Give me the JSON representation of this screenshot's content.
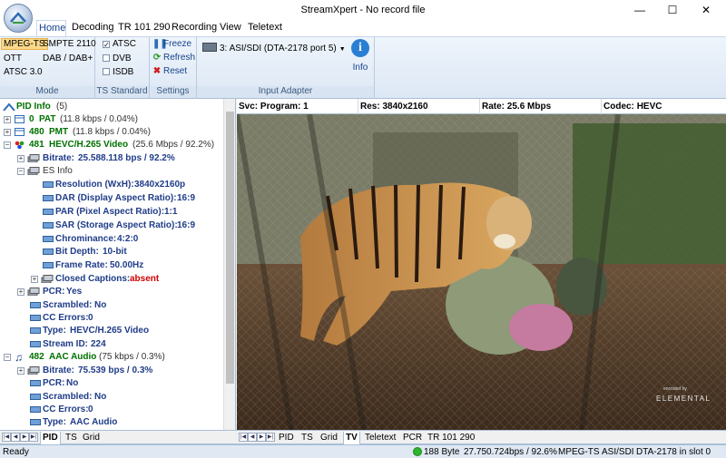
{
  "window": {
    "title": "StreamXpert - No record file",
    "minimize": "—",
    "maximize": "☐",
    "close": "✕"
  },
  "tabs": [
    "Home",
    "Decoding",
    "TR 101 290",
    "Recording",
    "View",
    "Teletext"
  ],
  "ribbon": {
    "mode": {
      "items": [
        "MPEG-TS",
        "SMPTE 2110",
        "OTT",
        "DAB / DAB+",
        "ATSC 3.0"
      ],
      "selected": "MPEG-TS",
      "label": "Mode"
    },
    "ts_standard": {
      "items": [
        {
          "label": "ATSC",
          "checked": true
        },
        {
          "label": "DVB",
          "checked": false
        },
        {
          "label": "ISDB",
          "checked": false
        }
      ],
      "label": "TS Standard"
    },
    "settings": {
      "freeze": "Freeze",
      "refresh": "Refresh",
      "reset": "Reset",
      "label": "Settings"
    },
    "input_adapter": {
      "device": "3: ASI/SDI (DTA-2178 port 5)",
      "label": "Input Adapter",
      "info": "Info"
    }
  },
  "tree": {
    "root_label": "PID Info",
    "root_count": "(5)",
    "pat": {
      "pid": "0",
      "name": "PAT",
      "rate": "(11.8 kbps / 0.04%)"
    },
    "pmt": {
      "pid": "480",
      "name": "PMT",
      "rate": "(11.8 kbps / 0.04%)"
    },
    "video": {
      "pid": "481",
      "name": "HEVC/H.265 Video",
      "rate": "(25.6 Mbps / 92.2%)",
      "bitrate_k": "Bitrate:",
      "bitrate_v": "25.588.118 bps / 92.2%",
      "es_info": "ES Info",
      "res_k": "Resolution (WxH):",
      "res_v": "3840x2160p",
      "dar_k": "DAR (Display Aspect Ratio):",
      "dar_v": "16:9",
      "par_k": "PAR (Pixel Aspect Ratio):",
      "par_v": "1:1",
      "sar_k": "SAR (Storage Aspect Ratio):",
      "sar_v": "16:9",
      "chroma_k": "Chrominance:",
      "chroma_v": "4:2:0",
      "depth_k": "Bit Depth:",
      "depth_v": "10-bit",
      "fr_k": "Frame Rate:",
      "fr_v": "50.00Hz",
      "cc_k": "Closed Captions:",
      "cc_v": "absent",
      "pcr_k": "PCR:",
      "pcr_v": "Yes",
      "scr_k": "Scrambled:",
      "scr_v": "No",
      "cce_k": "CC Errors:",
      "cce_v": "0",
      "type_k": "Type:",
      "type_v": "HEVC/H.265 Video",
      "sid_k": "Stream ID:",
      "sid_v": "224"
    },
    "audio": {
      "pid": "482",
      "name": "AAC Audio",
      "rate": "(75 kbps / 0.3%)",
      "bitrate_k": "Bitrate:",
      "bitrate_v": "75.539 bps / 0.3%",
      "pcr_k": "PCR:",
      "pcr_v": "No",
      "scr_k": "Scrambled:",
      "scr_v": "No",
      "cce_k": "CC Errors:",
      "cce_v": "0",
      "type_k": "Type:",
      "type_v": "AAC Audio"
    }
  },
  "left_tabs": [
    "PID",
    "TS",
    "Grid"
  ],
  "right_tabs": [
    "PID",
    "TS",
    "Grid",
    "TV",
    "Teletext",
    "PCR",
    "TR 101 290"
  ],
  "infobar": {
    "svc_k": "Svc:",
    "svc_v": "Program: 1",
    "res_k": "Res:",
    "res_v": "3840x2160",
    "rate_k": "Rate:",
    "rate_v": "25.6 Mbps",
    "codec_k": "Codec:",
    "codec_v": "HEVC"
  },
  "video": {
    "watermark_small": "encoded by",
    "watermark": "ELEMENTAL"
  },
  "status": {
    "ready": "Ready",
    "packet": "188 Byte",
    "rate": "27.750.724bps / 92.6%",
    "mode": "MPEG-TS",
    "iface": "ASI/SDI",
    "device": "DTA-2178 in slot 0"
  },
  "colors": {
    "accent": "#15428b",
    "selected": "#fbd88a",
    "green": "#007000",
    "status_ok": "#2db52d"
  }
}
